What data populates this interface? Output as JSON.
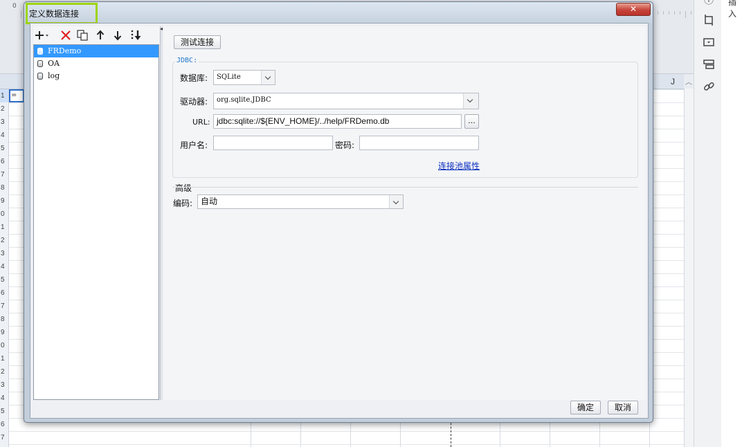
{
  "background": {
    "ruler_zero": "0",
    "column_label": "J",
    "row_numbers": [
      "1",
      "2",
      "3",
      "4",
      "5",
      "6",
      "7",
      "8",
      "9",
      "0",
      "1",
      "2",
      "3",
      "4",
      "5",
      "6",
      "7",
      "8",
      "9",
      "0",
      "1",
      "2",
      "3",
      "4",
      "5",
      "6",
      "7"
    ],
    "selected_cell_text": "=",
    "far_right_text": "插入"
  },
  "dialog": {
    "title": "定义数据连接",
    "close_symbol": "✕",
    "connections": [
      "FRDemo",
      "OA",
      "log"
    ],
    "selected_connection": "FRDemo",
    "test_button": "测试连接",
    "jdbc_legend": "JDBC:",
    "database_label": "数据库:",
    "database_value": "SQLite",
    "driver_label": "驱动器:",
    "driver_value": "org.sqlite.JDBC",
    "url_label": "URL:",
    "url_value": "jdbc:sqlite://${ENV_HOME}/../help/FRDemo.db",
    "browse_button": "...",
    "username_label": "用户名:",
    "username_value": "",
    "password_label": "密码:",
    "password_value": "",
    "pool_link": "连接池属性",
    "advanced_label": "高级",
    "encoding_label": "编码:",
    "encoding_value": "自动",
    "ok_button": "确定",
    "cancel_button": "取消"
  },
  "colors": {
    "selection": "#3399ff",
    "title_highlight": "#9dd40c",
    "close_button": "#c7443a",
    "link": "#0a2fbf",
    "legend": "#2276c9"
  }
}
